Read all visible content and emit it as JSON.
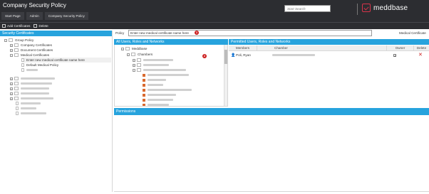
{
  "app": {
    "title": "Company Security Policy"
  },
  "tabs": [
    {
      "label": "Start Page"
    },
    {
      "label": "Admin"
    },
    {
      "label": "Company Security Policy"
    }
  ],
  "search": {
    "placeholder": "Start Search"
  },
  "brand": {
    "name": "meddbase",
    "color": "#d9334a"
  },
  "toolbar": {
    "add_label": "Add Certificates",
    "delete_label": "Delete"
  },
  "left_panel": {
    "title": "Security Certificates",
    "tree": [
      {
        "label": "Group Policy"
      },
      {
        "label": "Company Certificates"
      },
      {
        "label": "Document Certificates"
      },
      {
        "label": "Medical Certificates"
      },
      {
        "label": "Enter new medical certificate name here"
      },
      {
        "label": "Default Medical Policy"
      }
    ]
  },
  "policy": {
    "label": "Policy",
    "value": "Enter new medical certificate name here",
    "certificate_type": "Medical Certificate"
  },
  "markers": [
    "1",
    "2"
  ],
  "middle_panel": {
    "title": "All Users, Roles and Networks",
    "tree": [
      {
        "label": "Meddbase"
      },
      {
        "label": "Chambers"
      }
    ]
  },
  "right_panel": {
    "title": "Permitted Users, Roles and Networks",
    "columns": [
      "Members",
      "Chamber",
      "Owner",
      "Delete"
    ],
    "rows": [
      {
        "member": "Poli, Ryan",
        "owner_checked": "✓"
      }
    ]
  },
  "permissions": {
    "title": "Permissions"
  },
  "colors": {
    "accent": "#27a3dd",
    "header": "#2c2d31",
    "marker": "#cc1f1f"
  }
}
